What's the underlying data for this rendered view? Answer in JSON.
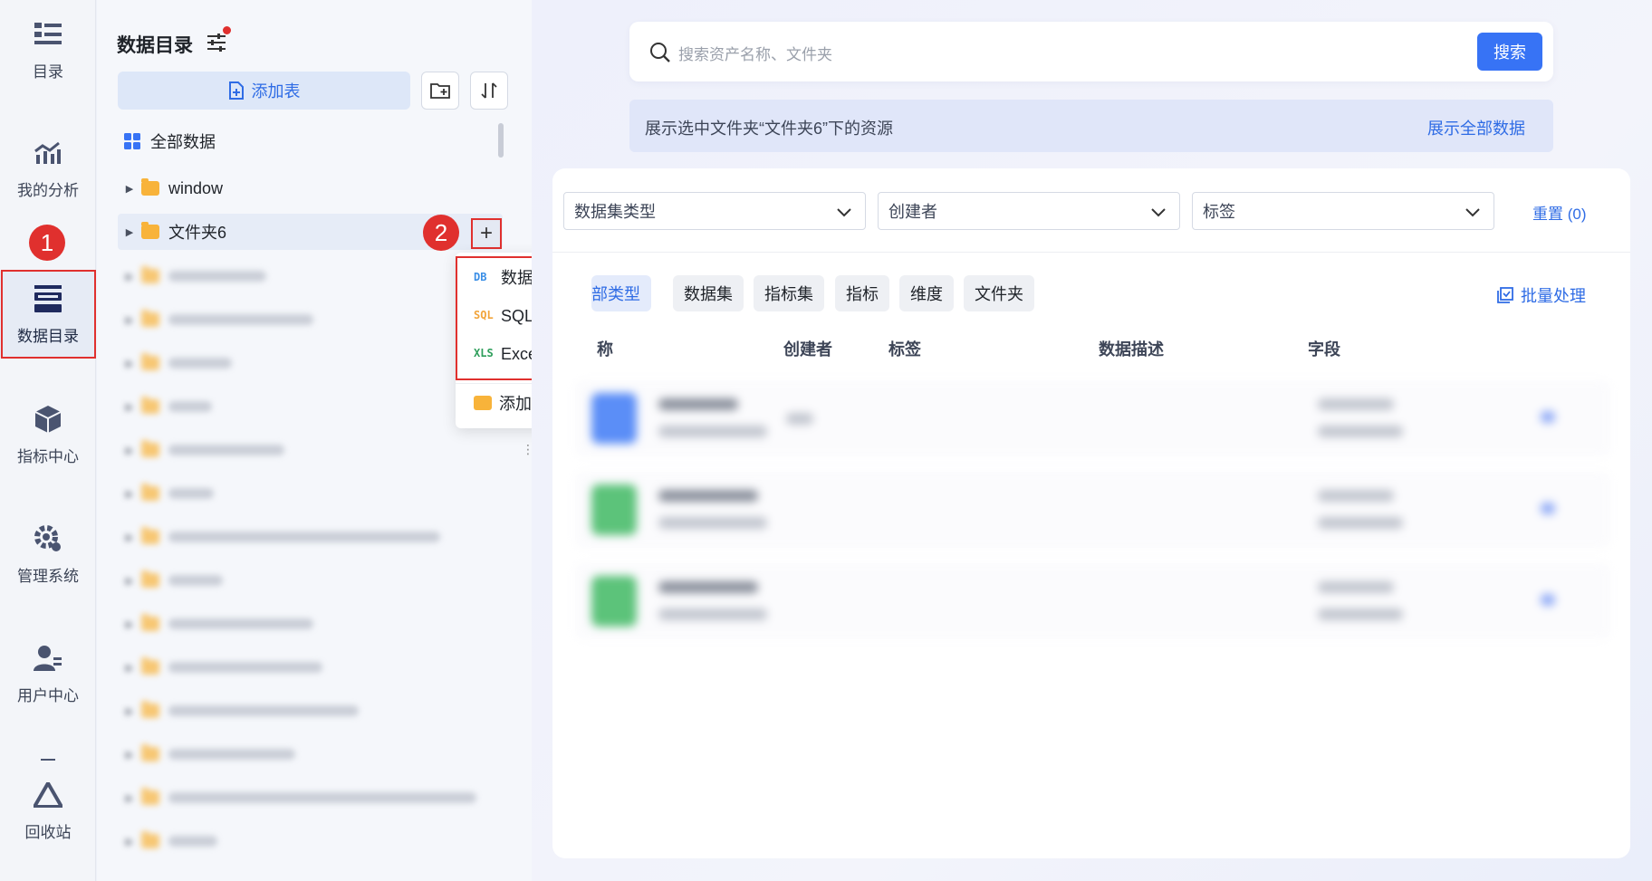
{
  "rail": {
    "items": [
      {
        "label": "目录",
        "icon": "list-icon"
      },
      {
        "label": "我的分析",
        "icon": "chart-icon"
      },
      {
        "label": "数据目录",
        "icon": "data-catalog-icon",
        "active": true
      },
      {
        "label": "指标中心",
        "icon": "cube-icon"
      },
      {
        "label": "管理系统",
        "icon": "gear-icon"
      },
      {
        "label": "用户中心",
        "icon": "user-icon"
      },
      {
        "label": "回收站",
        "icon": "recycle-icon"
      }
    ]
  },
  "annotations": {
    "step1": "1",
    "step2": "2"
  },
  "tree": {
    "title": "数据目录",
    "add_table": "添加表",
    "all_data": "全部数据",
    "folders": [
      {
        "label": "window"
      },
      {
        "label": "文件夹6"
      }
    ]
  },
  "menu": {
    "items": [
      {
        "icon_text": "DB",
        "label": "数据库表",
        "color": "#3a8ee6"
      },
      {
        "icon_text": "SQL",
        "label": "SQL数据集",
        "color": "#f2a43a"
      },
      {
        "icon_text": "XLS",
        "label": "Excel数据集",
        "color": "#2e9e5b"
      }
    ],
    "add_folder": "添加文件夹"
  },
  "search": {
    "placeholder": "搜索资产名称、文件夹",
    "button": "搜索"
  },
  "info": {
    "text": "展示选中文件夹“文件夹6”下的资源",
    "link": "展示全部数据"
  },
  "filters": {
    "dataset_type": "数据集类型",
    "creator": "创建者",
    "tag": "标签",
    "reset": "重置 (0)"
  },
  "chips": [
    "部类型",
    "数据集",
    "指标集",
    "指标",
    "维度",
    "文件夹"
  ],
  "batch": "批量处理",
  "table": {
    "headers": [
      "称",
      "创建者",
      "标签",
      "数据描述",
      "字段"
    ]
  },
  "colors": {
    "accent": "#3773f5",
    "highlight": "#e0302e",
    "folder": "#f8b33a"
  }
}
